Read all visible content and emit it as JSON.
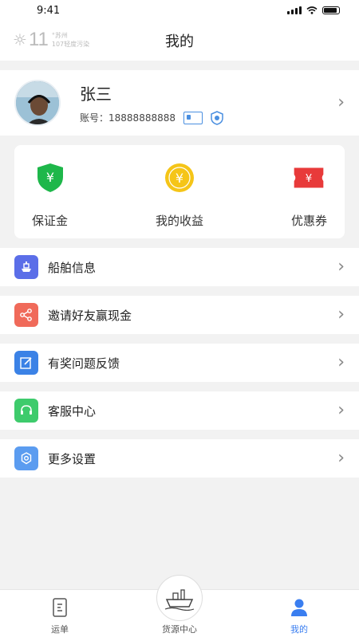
{
  "status_bar": {
    "time": "9:41"
  },
  "header": {
    "title": "我的",
    "weather": {
      "temp": "11",
      "unit": "°",
      "city": "苏州",
      "aqi": "107轻度污染"
    }
  },
  "profile": {
    "name": "张三",
    "account_label": "账号：",
    "account_number": "18888888888"
  },
  "wallet": {
    "items": [
      {
        "label": "保证金",
        "icon": "shield-yen-icon",
        "color": "#1eb74a"
      },
      {
        "label": "我的收益",
        "icon": "coin-yen-icon",
        "color": "#f5c518"
      },
      {
        "label": "优惠券",
        "icon": "ticket-yen-icon",
        "color": "#e83a3a"
      }
    ]
  },
  "menu": {
    "items": [
      {
        "label": "船舶信息",
        "icon": "ship-icon",
        "color": "#5b6ee8"
      },
      {
        "label": "邀请好友赢现金",
        "icon": "share-icon",
        "color": "#f06a5a"
      },
      {
        "label": "有奖问题反馈",
        "icon": "edit-icon",
        "color": "#3b82e6"
      },
      {
        "label": "客服中心",
        "icon": "headset-icon",
        "color": "#3ecb6c"
      },
      {
        "label": "更多设置",
        "icon": "settings-icon",
        "color": "#5b9cf0"
      }
    ]
  },
  "tabbar": {
    "tabs": [
      {
        "label": "运单",
        "icon": "document-icon"
      },
      {
        "label": "货源中心",
        "icon": "cargo-ship-icon"
      },
      {
        "label": "我的",
        "icon": "user-icon",
        "active": true
      }
    ],
    "active_color": "#3a7ef0"
  }
}
